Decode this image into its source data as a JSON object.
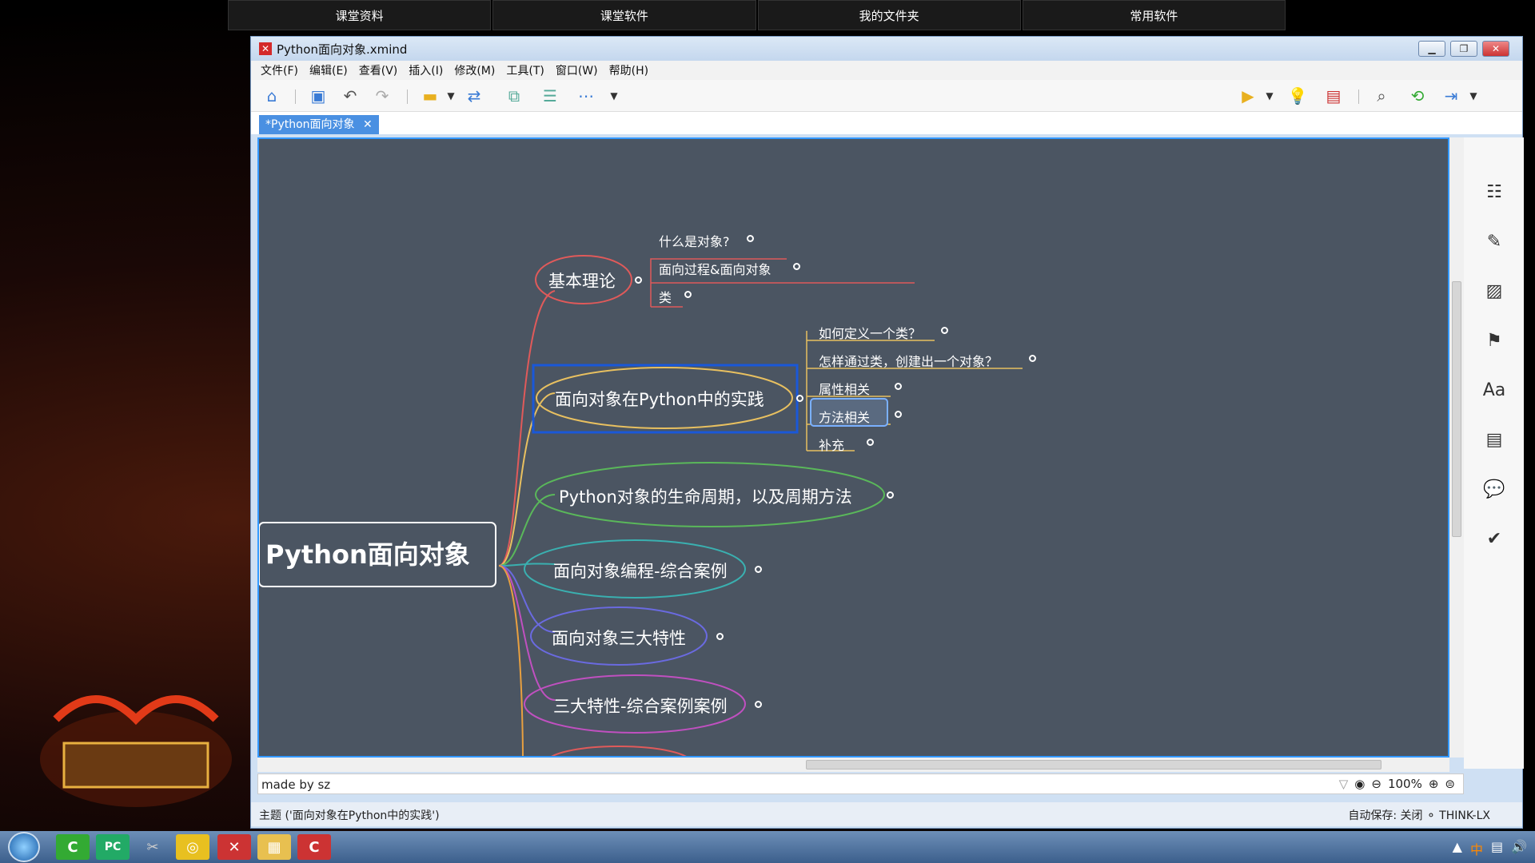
{
  "top_buttons": [
    "课堂资料",
    "课堂软件",
    "我的文件夹",
    "常用软件"
  ],
  "window": {
    "title": "Python面向对象.xmind",
    "icon": "xmind-icon",
    "min": "minimize-icon",
    "max": "maximize-icon",
    "close": "close-icon"
  },
  "menu": [
    "文件(F)",
    "编辑(E)",
    "查看(V)",
    "插入(I)",
    "修改(M)",
    "工具(T)",
    "窗口(W)",
    "帮助(H)"
  ],
  "tab": {
    "label": "*Python面向对象",
    "close": "✕"
  },
  "mindmap": {
    "root": "Python面向对象",
    "branches": [
      {
        "label": "基本理论",
        "color": "#e05a5a",
        "children": [
          "什么是对象?",
          "面向过程&面向对象",
          "类"
        ]
      },
      {
        "label": "面向对象在Python中的实践",
        "color": "#e8c060",
        "children": [
          "如何定义一个类？",
          "怎样通过类，创建出一个对象？",
          "属性相关",
          "方法相关",
          "补充"
        ]
      },
      {
        "label": "Python对象的生命周期，以及周期方法",
        "color": "#5ab85a",
        "children": []
      },
      {
        "label": "面向对象编程-综合案例",
        "color": "#3ab0b0",
        "children": []
      },
      {
        "label": "面向对象三大特性",
        "color": "#6a6ae0",
        "children": []
      },
      {
        "label": "三大特性-综合案例案例",
        "color": "#c050c0",
        "children": []
      }
    ]
  },
  "bottom": {
    "madeby": "made by sz",
    "zoom": "100%"
  },
  "status": {
    "left": "主题 ('面向对象在Python中的实践')",
    "right": "自动保存: 关闭   ⚬ THINK-LX"
  },
  "colors": {
    "canvas": "#4b5562",
    "accent": "#3399ff"
  }
}
